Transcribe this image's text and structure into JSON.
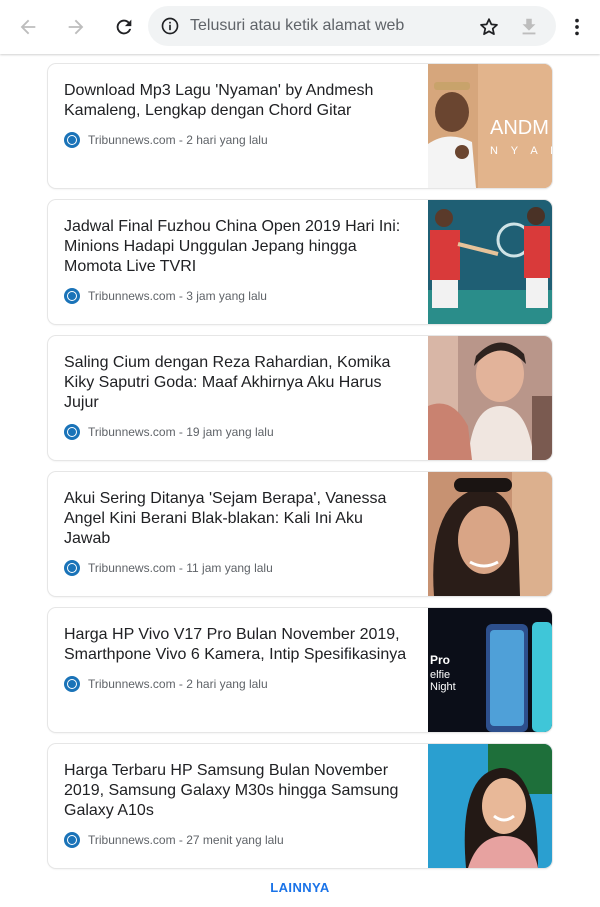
{
  "browser": {
    "omnibox_placeholder": "Telusuri atau ketik alamat web",
    "icons": [
      "back-icon",
      "forward-icon",
      "reload-icon",
      "info-icon",
      "star-icon",
      "download-icon",
      "menu-icon"
    ]
  },
  "feed": {
    "articles": [
      {
        "title": "Download Mp3 Lagu 'Nyaman' by Andmesh Kamaleng, Lengkap dengan Chord Gitar",
        "meta": "Tribunnews.com - 2 hari yang lalu",
        "thumb_text": "ANDM N Y A M"
      },
      {
        "title": "Jadwal Final Fuzhou China Open 2019 Hari Ini: Minions Hadapi Unggulan Jepang hingga Momota Live TVRI",
        "meta": "Tribunnews.com - 3 jam yang lalu"
      },
      {
        "title": "Saling Cium dengan Reza Rahardian, Komika Kiky Saputri Goda: Maaf Akhirnya Aku Harus Jujur",
        "meta": "Tribunnews.com - 19 jam yang lalu"
      },
      {
        "title": "Akui Sering Ditanya 'Sejam Berapa', Vanessa Angel Kini Berani Blak-blakan: Kali Ini Aku Jawab",
        "meta": "Tribunnews.com - 11 jam yang lalu"
      },
      {
        "title": "Harga HP Vivo V17 Pro Bulan November 2019, Smarthpone Vivo 6 Kamera, Intip Spesifikasinya",
        "meta": "Tribunnews.com - 2 hari yang lalu",
        "thumb_text": "Pro elfie Night"
      },
      {
        "title": "Harga Terbaru HP Samsung Bulan November 2019, Samsung Galaxy M30s hingga Samsung Galaxy A10s",
        "meta": "Tribunnews.com - 27 menit yang lalu"
      }
    ],
    "more_label": "LAINNYA"
  },
  "colors": {
    "accent": "#1a73e8",
    "source_logo": "#1a73b8"
  }
}
